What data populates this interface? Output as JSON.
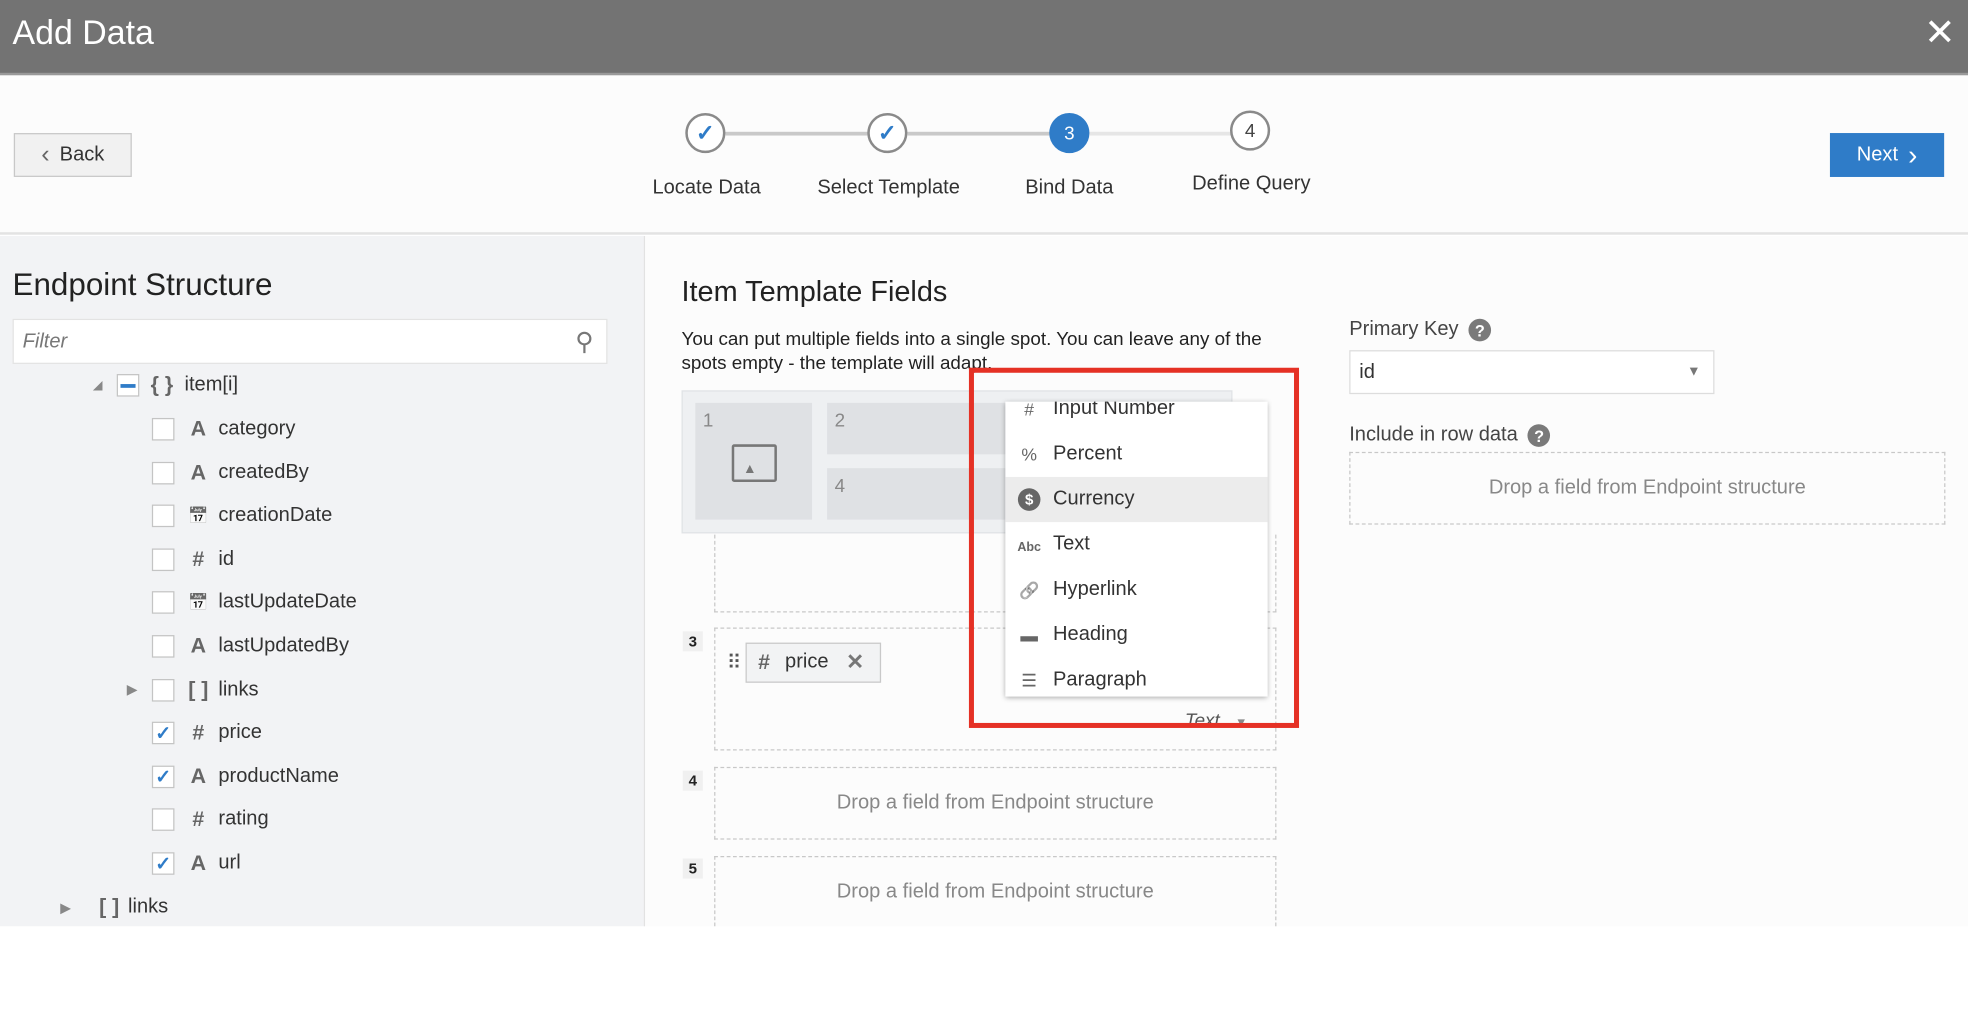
{
  "header": {
    "title": "Add Data",
    "close_icon": "close-icon"
  },
  "toolbar": {
    "back_label": "Back",
    "next_label": "Next",
    "steps": [
      {
        "label": "Locate Data",
        "state": "done"
      },
      {
        "label": "Select Template",
        "state": "done"
      },
      {
        "label": "Bind Data",
        "number": "3",
        "state": "active"
      },
      {
        "label": "Define Query",
        "number": "4",
        "state": "pending"
      }
    ]
  },
  "left": {
    "title": "Endpoint Structure",
    "filter_placeholder": "Filter",
    "root": {
      "label": "item[i]",
      "state": "partial"
    },
    "items": [
      {
        "label": "category",
        "type": "A",
        "checked": false
      },
      {
        "label": "createdBy",
        "type": "A",
        "checked": false
      },
      {
        "label": "creationDate",
        "type": "date",
        "checked": false
      },
      {
        "label": "id",
        "type": "#",
        "checked": false
      },
      {
        "label": "lastUpdateDate",
        "type": "date",
        "checked": false
      },
      {
        "label": "lastUpdatedBy",
        "type": "A",
        "checked": false
      },
      {
        "label": "links",
        "type": "[]",
        "checked": false,
        "expandable": true
      },
      {
        "label": "price",
        "type": "#",
        "checked": true
      },
      {
        "label": "productName",
        "type": "A",
        "checked": true
      },
      {
        "label": "rating",
        "type": "#",
        "checked": false
      },
      {
        "label": "url",
        "type": "A",
        "checked": true
      }
    ],
    "bottom": {
      "label": "links"
    }
  },
  "main": {
    "title": "Item Template Fields",
    "description": "You can put multiple fields into a single spot. You can leave any of the spots empty - the template will adapt.",
    "preview_cells": [
      "1",
      "2",
      "4"
    ],
    "slot3": {
      "number": "3",
      "chip": "price",
      "format": "Text"
    },
    "slot4": {
      "number": "4",
      "placeholder": "Drop a field from Endpoint structure"
    },
    "slot5": {
      "number": "5",
      "placeholder": "Drop a field from Endpoint structure"
    },
    "menu": [
      {
        "label": "Input Number",
        "icon": "#"
      },
      {
        "label": "Percent",
        "icon": "%"
      },
      {
        "label": "Currency",
        "icon": "$",
        "highlighted": true
      },
      {
        "label": "Text",
        "icon": "Abc"
      },
      {
        "label": "Hyperlink",
        "icon": "link"
      },
      {
        "label": "Heading",
        "icon": "heading"
      },
      {
        "label": "Paragraph",
        "icon": "paragraph"
      }
    ]
  },
  "right": {
    "primary_key_label": "Primary Key",
    "primary_key_value": "id",
    "include_label": "Include in row data",
    "include_placeholder": "Drop a field from Endpoint structure"
  },
  "colors": {
    "accent": "#2f7cc8",
    "header": "#737373",
    "highlight_box": "#e53125"
  }
}
